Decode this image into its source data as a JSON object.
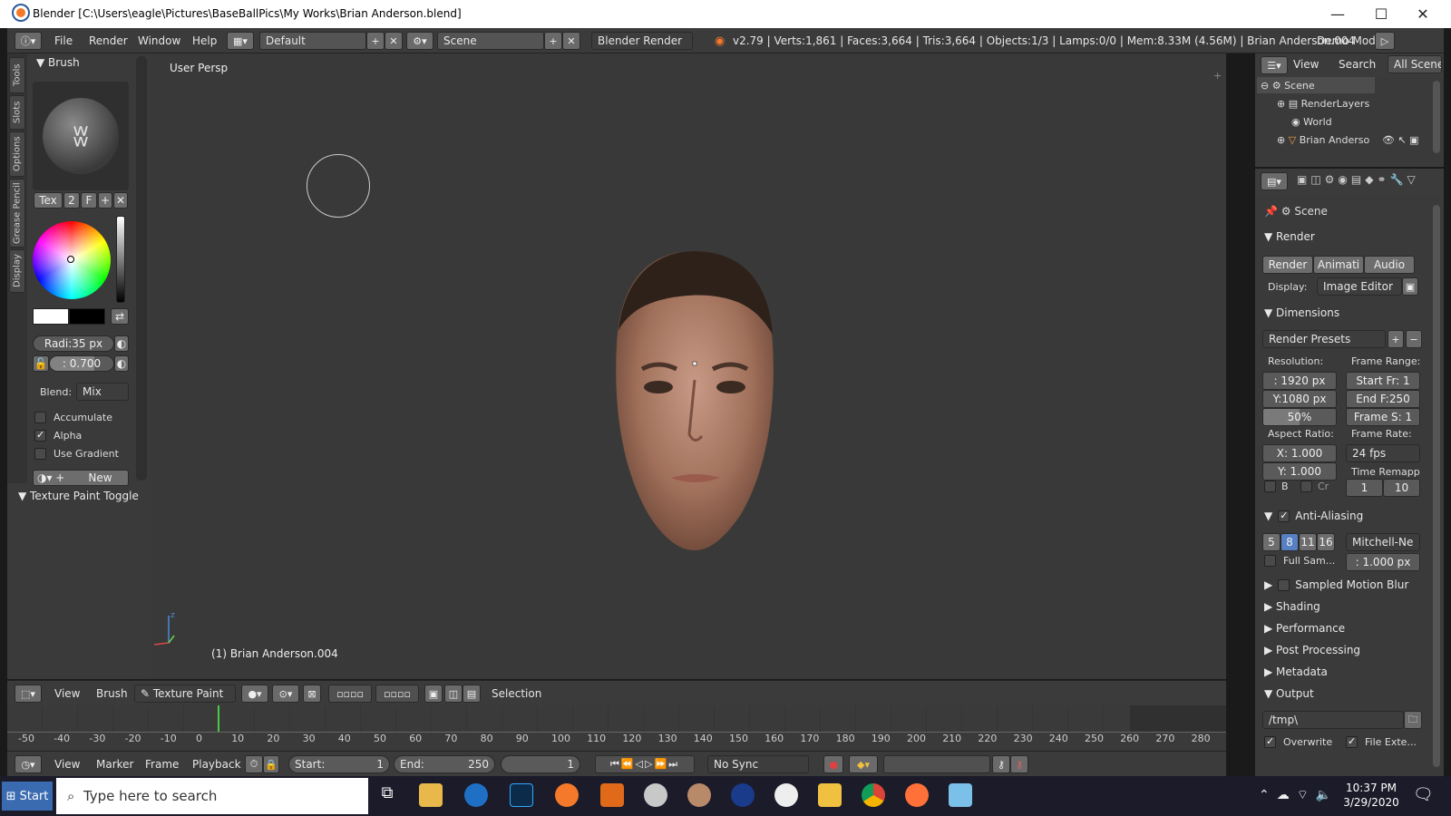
{
  "window": {
    "title": "Blender [C:\\Users\\eagle\\Pictures\\BaseBallPics\\My Works\\Brian Anderson.blend]",
    "minimize": "—",
    "maximize": "☐",
    "close": "✕"
  },
  "infobar": {
    "menus": [
      "File",
      "Render",
      "Window",
      "Help"
    ],
    "layout": "Default",
    "scene": "Scene",
    "engine": "Blender Render",
    "stats": "v2.79 | Verts:1,861 | Faces:3,664 | Tris:3,664 | Objects:1/3 | Lamps:0/0 | Mem:8.33M (4.56M) | Brian Anderson.004",
    "demo_mode": "Demo Mode:"
  },
  "toolshelf": {
    "tabs": [
      "Tools",
      "Slots",
      "Options",
      "Grease Pencil",
      "Display"
    ],
    "brush_panel": "Brush",
    "tex_label": "Tex",
    "user_count": "2",
    "fake_user": "F",
    "radius": "Radi:35 px",
    "strength": ": 0.700",
    "blend_label": "Blend:",
    "blend_value": "Mix",
    "checks": [
      {
        "label": "Accumulate",
        "checked": false
      },
      {
        "label": "Alpha",
        "checked": true
      },
      {
        "label": "Use Gradient",
        "checked": false
      }
    ],
    "new_label": "New",
    "texture_paint_toggle": "Texture Paint Toggle"
  },
  "viewport": {
    "view_label": "User Persp",
    "object_label": "(1) Brian Anderson.004"
  },
  "vpheader": {
    "view": "View",
    "brush": "Brush",
    "mode": "Texture Paint",
    "selection": "Selection"
  },
  "timeline": {
    "ticks": [
      "-50",
      "-40",
      "-30",
      "-20",
      "-10",
      "0",
      "10",
      "20",
      "30",
      "40",
      "50",
      "60",
      "70",
      "80",
      "90",
      "100",
      "110",
      "120",
      "130",
      "140",
      "150",
      "160",
      "170",
      "180",
      "190",
      "200",
      "210",
      "220",
      "230",
      "240",
      "250",
      "260",
      "270",
      "280"
    ],
    "current_frame": 0
  },
  "tlheader": {
    "view": "View",
    "marker": "Marker",
    "frame": "Frame",
    "playback": "Playback",
    "start": "Start:",
    "start_val": "1",
    "end": "End:",
    "end_val": "250",
    "current": "1",
    "sync": "No Sync"
  },
  "outliner": {
    "view": "View",
    "search": "Search",
    "all_scenes": "All Scenes",
    "items": [
      "Scene",
      "RenderLayers",
      "World",
      "Brian Anderso"
    ]
  },
  "props": {
    "scene": "Scene",
    "render_panel": "Render",
    "render_btn": "Render",
    "anim_btn": "Animati",
    "audio_btn": "Audio",
    "display_label": "Display:",
    "display_value": "Image Editor",
    "dimensions": "Dimensions",
    "presets": "Render Presets",
    "resolution_label": "Resolution:",
    "res_x": ": 1920 px",
    "res_y": "Y:1080 px",
    "res_pct": "50%",
    "frame_range_label": "Frame Range:",
    "start_fr": "Start Fr: 1",
    "end_fr": "End F:250",
    "frame_step": "Frame S: 1",
    "aspect_label": "Aspect Ratio:",
    "asp_x": "X:  1.000",
    "asp_y": "Y:  1.000",
    "frame_rate_label": "Frame Rate:",
    "fps": "24 fps",
    "time_remap": "Time Remapp",
    "b_label": "B",
    "cr_label": "Cr",
    "remap_old": "1",
    "remap_new": "10",
    "aa_label": "Anti-Aliasing",
    "aa_samples": [
      "5",
      "8",
      "11",
      "16"
    ],
    "aa_filter": "Mitchell-Ne",
    "full_sample": "Full Sam...",
    "filter_size": ": 1.000 px",
    "motion_blur": "Sampled Motion Blur",
    "shading": "Shading",
    "performance": "Performance",
    "post_processing": "Post Processing",
    "metadata": "Metadata",
    "output": "Output",
    "output_path": "/tmp\\",
    "overwrite": "Overwrite",
    "file_ext": "File Exte..."
  },
  "taskbar": {
    "start": "Start",
    "search_placeholder": "Type here to search",
    "time": "10:37 PM",
    "date": "3/29/2020"
  },
  "colors": {
    "accent": "#5680c2",
    "bg": "#393939",
    "panel": "#3a3a3a"
  }
}
